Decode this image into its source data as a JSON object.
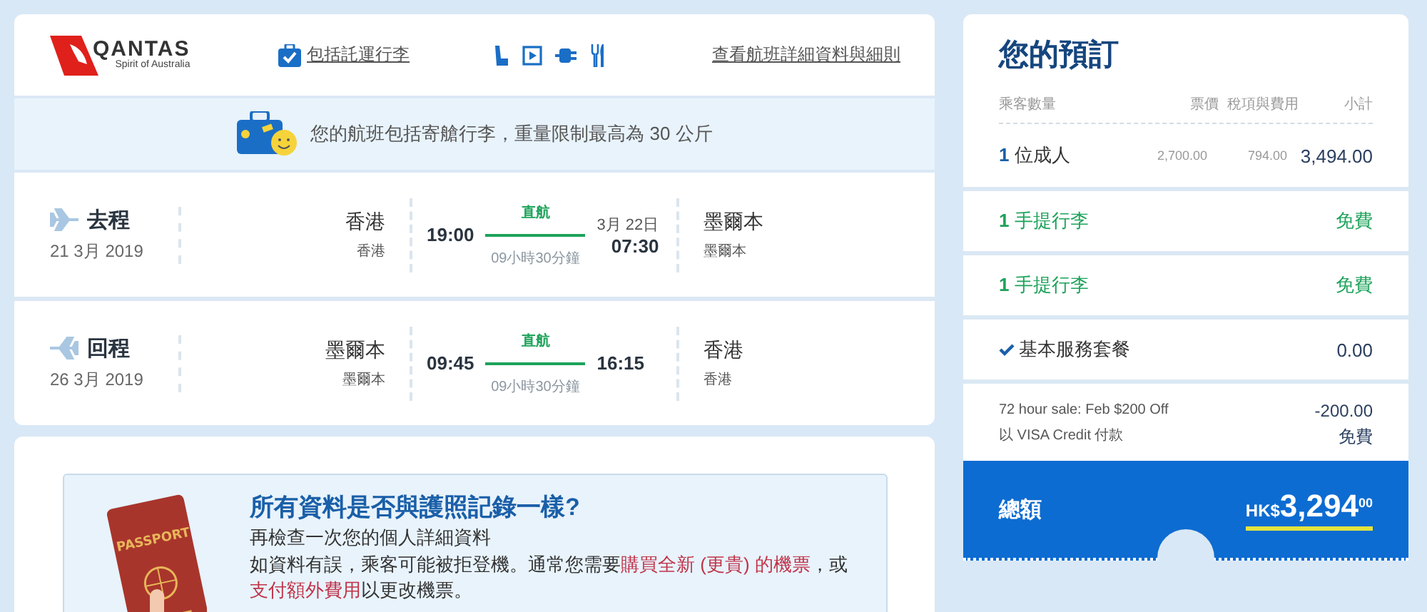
{
  "header": {
    "logo_name": "QANTAS",
    "logo_tagline": "Spirit of Australia",
    "baggage_link": "包括託運行李",
    "details_link": "查看航班詳細資料與細則"
  },
  "baggage_notice": "您的航班包括寄艙行李，重量限制最高為 30 公斤",
  "flights": [
    {
      "kind": "outbound",
      "direction": "去程",
      "date": "21 3月 2019",
      "origin_city": "香港",
      "origin_airport": "香港",
      "depart_time": "19:00",
      "stops": "直航",
      "duration": "09小時30分鐘",
      "arrival_date": "3月 22日",
      "arrive_time": "07:30",
      "dest_city": "墨爾本",
      "dest_airport": "墨爾本"
    },
    {
      "kind": "return",
      "direction": "回程",
      "date": "26 3月 2019",
      "origin_city": "墨爾本",
      "origin_airport": "墨爾本",
      "depart_time": "09:45",
      "stops": "直航",
      "duration": "09小時30分鐘",
      "arrive_time": "16:15",
      "dest_city": "香港",
      "dest_airport": "香港"
    }
  ],
  "passport_check": {
    "illustration_label": "PASSPORT",
    "title": "所有資料是否與護照記錄一樣?",
    "subtitle": "再檢查一次您的個人詳細資料",
    "body": [
      {
        "kind": "text",
        "text": "如資料有誤，乘客可能被拒登機。通常您需要"
      },
      {
        "kind": "link",
        "text": "購買全新 (更貴) 的機票"
      },
      {
        "kind": "text",
        "text": "，或"
      },
      {
        "kind": "link",
        "text": "支付額外費用"
      },
      {
        "kind": "text",
        "text": "以更改機票。"
      }
    ]
  },
  "booking": {
    "title": "您的預訂",
    "columns": [
      "乘客數量",
      "票價",
      "稅項與費用",
      "小計"
    ],
    "passengers": {
      "count": "1",
      "label": "位成人",
      "fare": "2,700.00",
      "tax": "794.00",
      "subtotal": "3,494.00"
    },
    "items": [
      {
        "kind": "baggage",
        "count": "1",
        "label": "手提行李",
        "price": "免費"
      },
      {
        "kind": "baggage",
        "count": "1",
        "label": "手提行李",
        "price": "免費"
      },
      {
        "kind": "service",
        "label": "基本服務套餐",
        "price": "0.00"
      }
    ],
    "adjustments": [
      {
        "label": "72 hour sale: Feb $200 Off",
        "value": "-200.00"
      },
      {
        "label": "以 VISA Credit 付款",
        "value": "免費"
      }
    ],
    "total": {
      "label": "總額",
      "currency": "HK$",
      "amount": "3,294",
      "cents": "00"
    }
  }
}
